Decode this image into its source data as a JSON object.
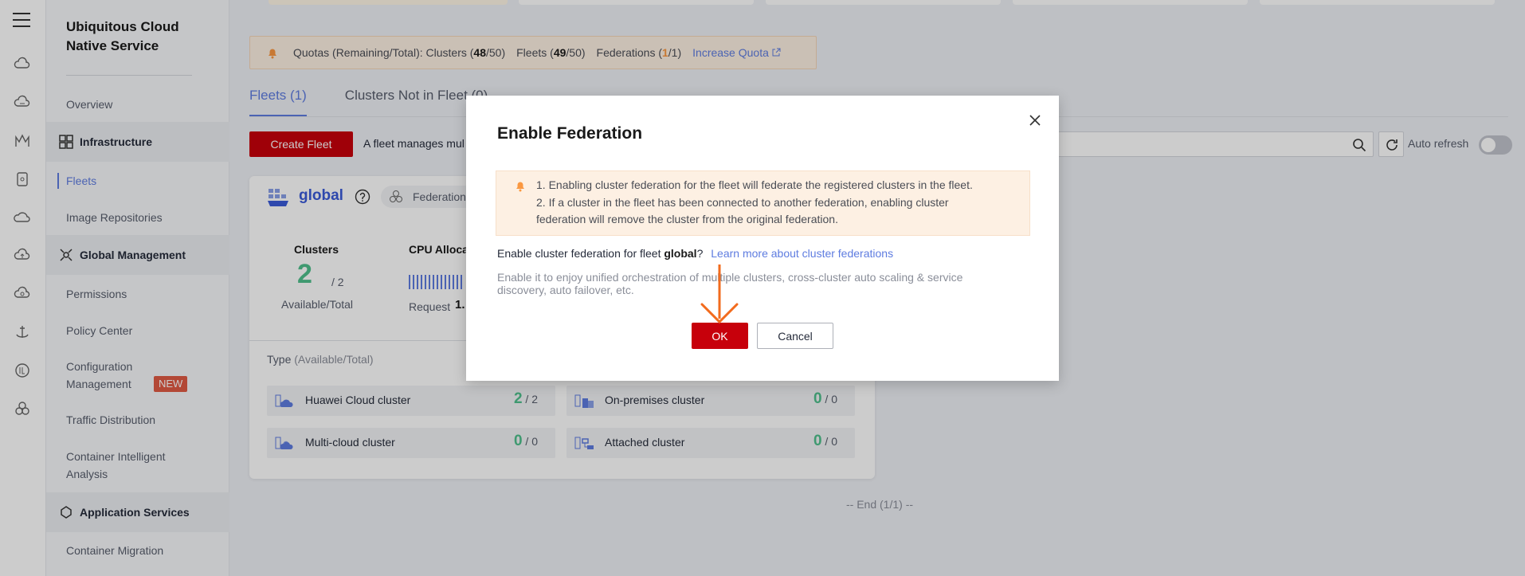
{
  "sidebar": {
    "title": "Ubiquitous Cloud Native Service",
    "overview": "Overview",
    "infrastructure": {
      "label": "Infrastructure",
      "icon": "grid-icon"
    },
    "fleets": "Fleets",
    "image_repositories": "Image Repositories",
    "global_management": {
      "label": "Global Management",
      "icon": "globe-network-icon"
    },
    "permissions": "Permissions",
    "policy_center": "Policy Center",
    "configuration_management_line1": "Configuration",
    "configuration_management_line2": "Management",
    "new_badge": "NEW",
    "traffic_distribution": "Traffic Distribution",
    "container_intelligent_analysis_line1": "Container Intelligent",
    "container_intelligent_analysis_line2": "Analysis",
    "application_services": {
      "label": "Application Services",
      "icon": "app-services-icon"
    },
    "container_migration": "Container Migration"
  },
  "quota_bar": {
    "prefix": "Quotas (Remaining/Total): Clusters (",
    "clusters_remaining": "48",
    "clusters_total": "/50)",
    "fleets_prefix": "Fleets (",
    "fleets_remaining": "49",
    "fleets_total": "/50)",
    "federations_prefix": "Federations (",
    "federations_remaining": "1",
    "federations_total": "/1)",
    "increase_link": "Increase Quota"
  },
  "tabs": [
    {
      "label": "Fleets (1)",
      "active": true
    },
    {
      "label": "Clusters Not in Fleet (0)",
      "active": false
    }
  ],
  "toolbar": {
    "create_fleet": "Create Fleet",
    "description": "A fleet manages mul",
    "auto_refresh": "Auto refresh",
    "auto_refresh_on": false
  },
  "fleet_card": {
    "name": "global",
    "federation_tag": "Federation",
    "clusters_label": "Clusters",
    "clusters_available": "2",
    "clusters_total": "/ 2",
    "available_total": "Available/Total",
    "cpu_label": "CPU Alloca",
    "request_label": "Request",
    "request_value": "1.",
    "type_label": "Type",
    "type_sub": "(Available/Total)",
    "types": [
      {
        "name": "Huawei Cloud cluster",
        "available": "2",
        "total": "/ 2",
        "icon": "cloud-cluster-icon"
      },
      {
        "name": "On-premises cluster",
        "available": "0",
        "total": "/ 0",
        "icon": "building-cluster-icon"
      },
      {
        "name": "Multi-cloud cluster",
        "available": "0",
        "total": "/ 0",
        "icon": "multicloud-cluster-icon"
      },
      {
        "name": "Attached cluster",
        "available": "0",
        "total": "/ 0",
        "icon": "attached-cluster-icon"
      }
    ]
  },
  "end_text": "-- End (1/1) --",
  "dialog": {
    "title": "Enable Federation",
    "alert_line1": "1. Enabling cluster federation for the fleet will federate the registered clusters in the fleet.",
    "alert_line2": "2. If a cluster in the fleet has been connected to another federation, enabling cluster",
    "alert_line3": "federation will remove the cluster from the original federation.",
    "question_prefix": "Enable cluster federation for fleet ",
    "question_fleet": "global",
    "question_suffix": "?",
    "learn_more": "Learn more about cluster federations",
    "hint": "Enable it to enjoy unified orchestration of multiple clusters, cross-cluster auto scaling & service discovery, auto failover, etc.",
    "ok": "OK",
    "cancel": "Cancel"
  },
  "colors": {
    "primary_red": "#c7000b",
    "link_blue": "#5e7ce0",
    "success_green": "#4fc08d",
    "warning_orange": "#fa9841",
    "annotation_arrow": "#f26b1d"
  }
}
